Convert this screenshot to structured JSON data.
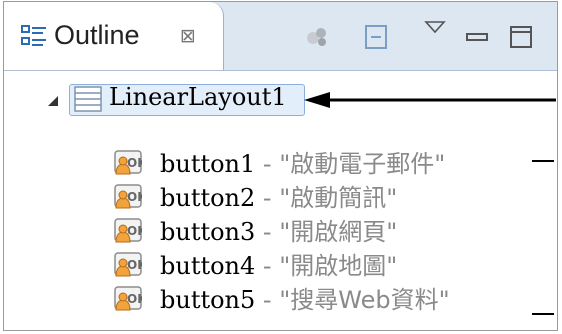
{
  "view_tab": {
    "title": "Outline",
    "close_glyph": "⊠"
  },
  "toolbar": {
    "icons": [
      "refresh-icon",
      "collapse-all-icon",
      "view-menu-icon",
      "minimize-icon",
      "maximize-icon"
    ]
  },
  "tree": {
    "root": {
      "label": "LinearLayout1",
      "expanded": true,
      "icon": "linear-layout-icon"
    },
    "children": [
      {
        "id": "button1",
        "separator": " - ",
        "text": "\"啟動電子郵件\"",
        "icon": "ok-button-icon"
      },
      {
        "id": "button2",
        "separator": " - ",
        "text": "\"啟動簡訊\"",
        "icon": "ok-button-icon"
      },
      {
        "id": "button3",
        "separator": " - ",
        "text": "\"開啟網頁\"",
        "icon": "ok-button-icon"
      },
      {
        "id": "button4",
        "separator": " - ",
        "text": "\"開啟地圖\"",
        "icon": "ok-button-icon"
      },
      {
        "id": "button5",
        "separator": " - ",
        "text": "\"搜尋Web資料\"",
        "icon": "ok-button-icon"
      }
    ]
  },
  "colors": {
    "tabbar": "#dde7f2",
    "selection": "#e2eef9",
    "selection_border": "#8cb0d9",
    "secondary_text": "#8a8a8a"
  }
}
